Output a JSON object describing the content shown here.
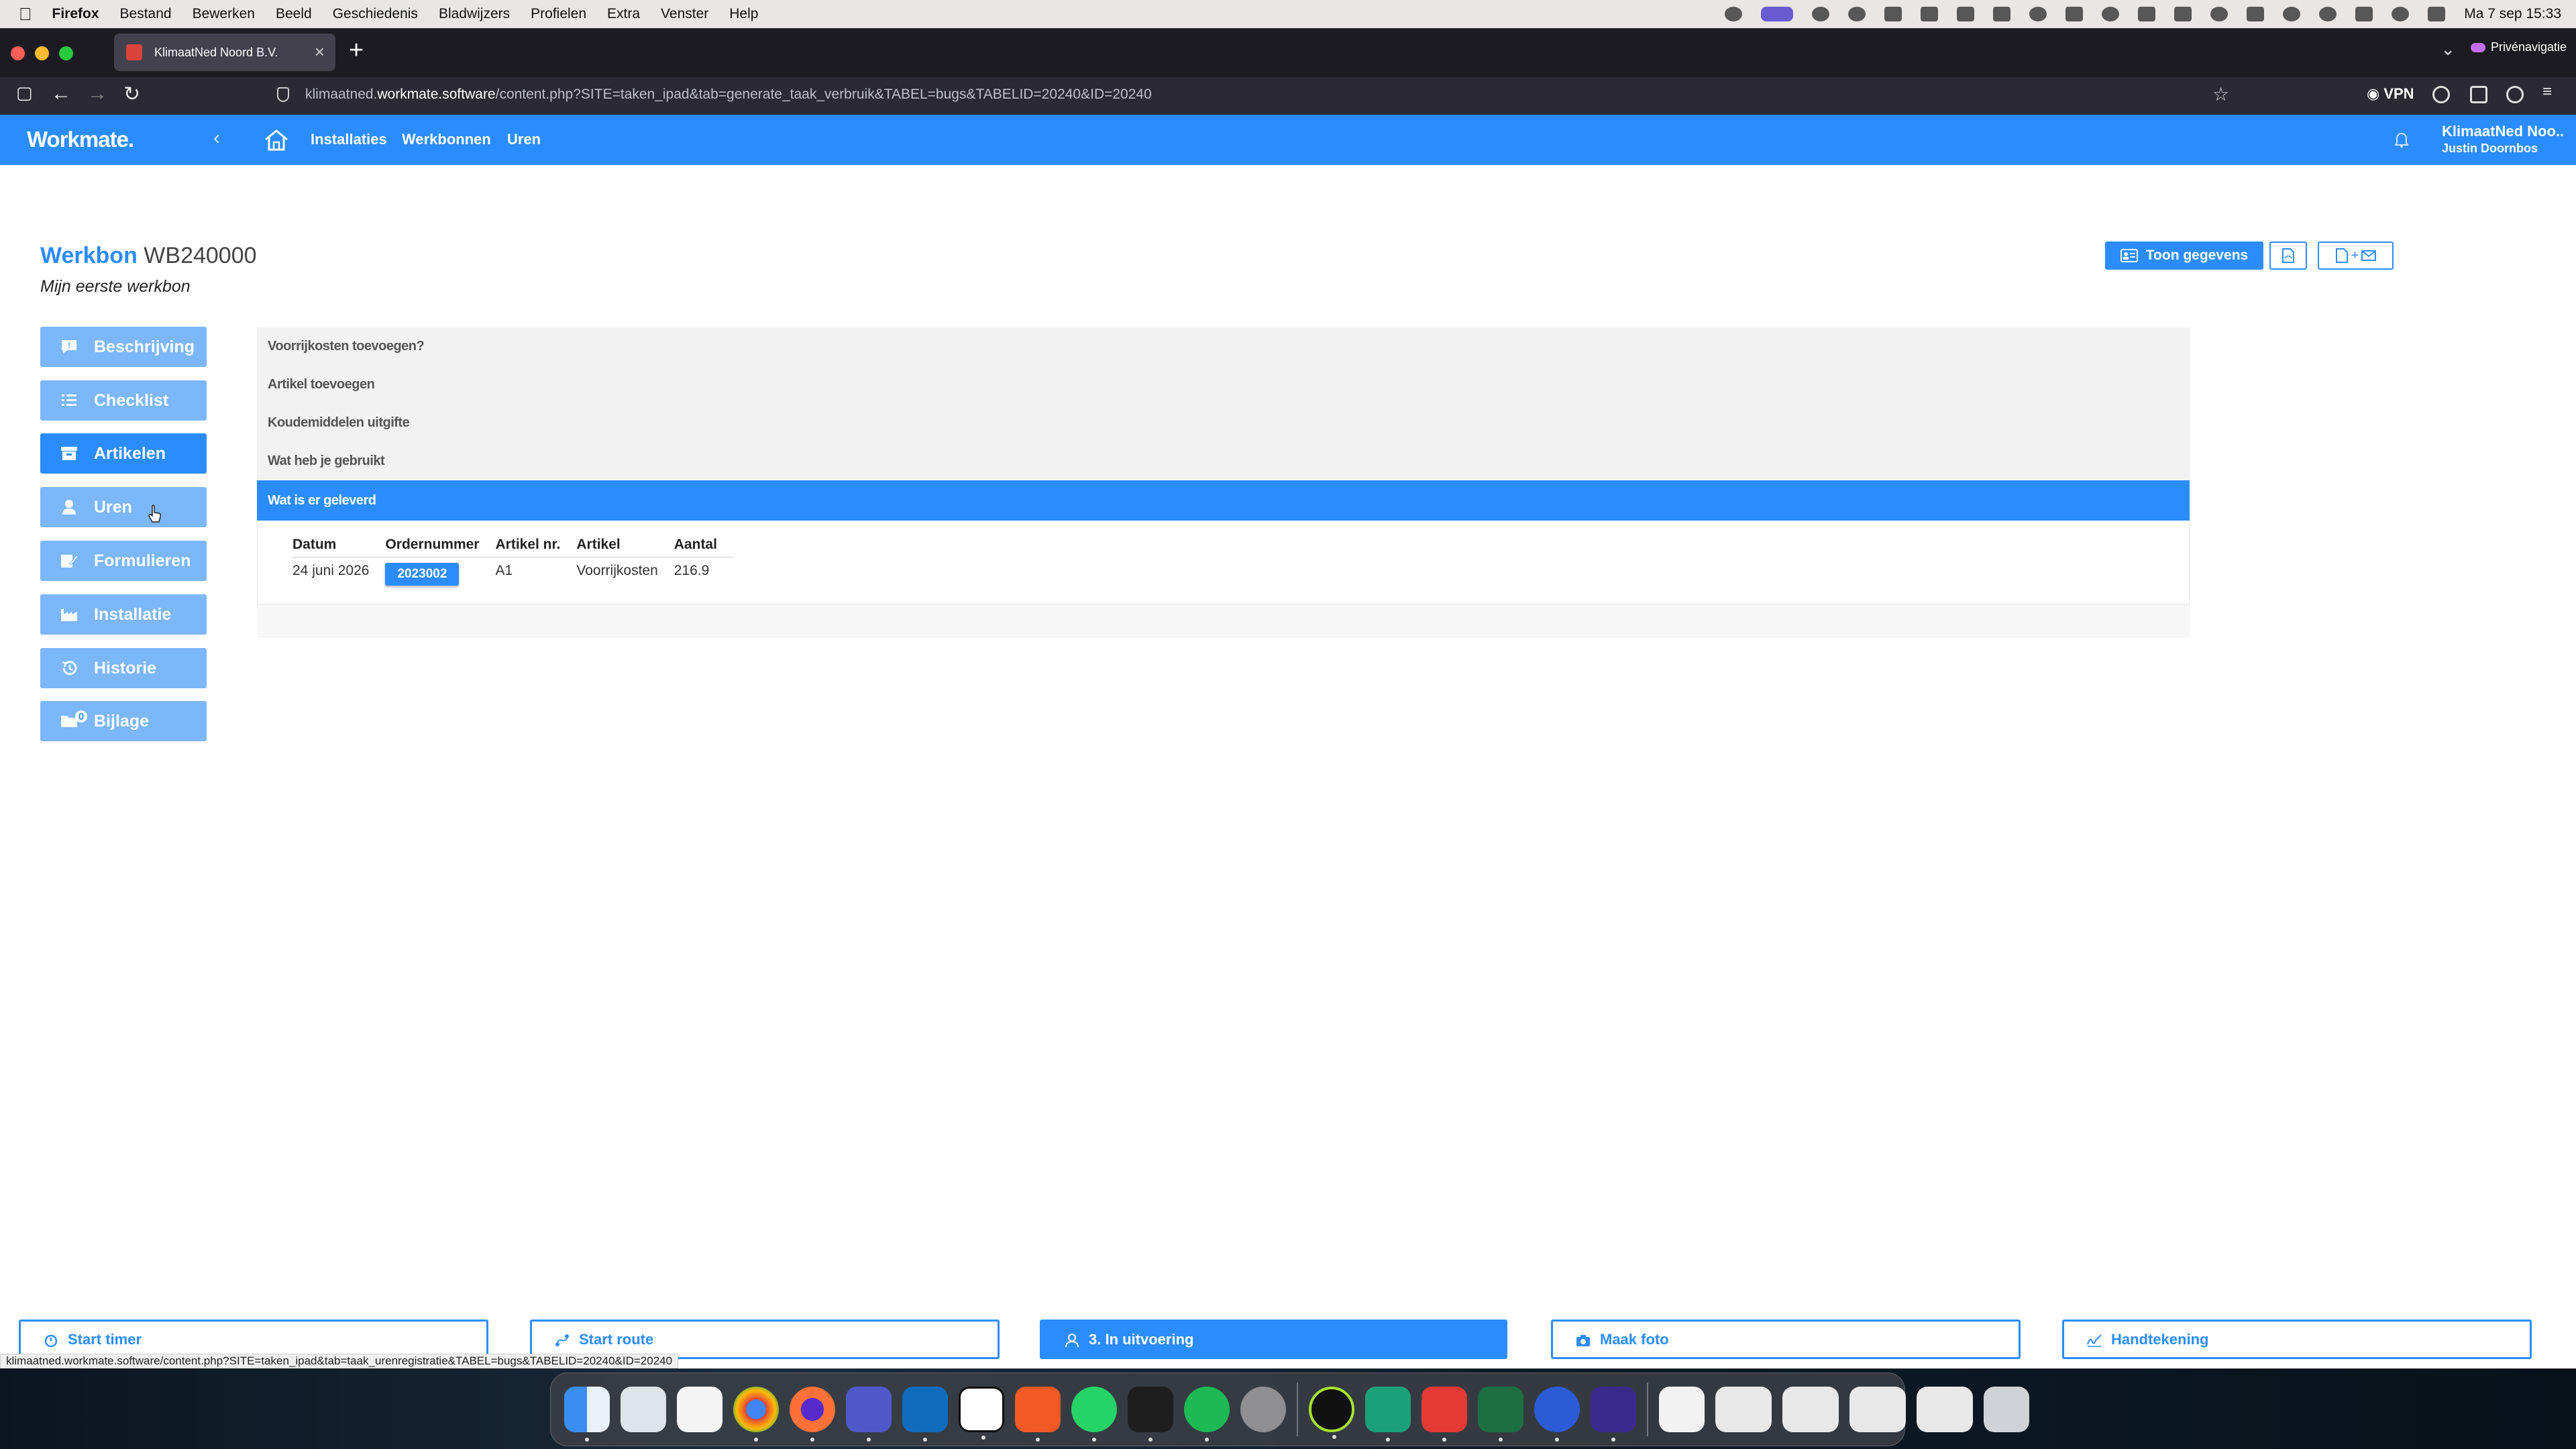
{
  "menubar": {
    "app": "Firefox",
    "items": [
      "Bestand",
      "Bewerken",
      "Beeld",
      "Geschiedenis",
      "Bladwijzers",
      "Profielen",
      "Extra",
      "Venster",
      "Help"
    ],
    "clock": "Ma 7 sep  15:33"
  },
  "browser": {
    "tab_title": "KlimaatNed Noord B.V.",
    "private_label": "Privénavigatie",
    "url_prefix": "klimaatned.",
    "url_domain": "workmate.software",
    "url_rest": "/content.php?SITE=taken_ipad&tab=generate_taak_verbruik&TABEL=bugs&TABELID=20240&ID=20240",
    "vpn_label": "VPN",
    "status_url": "klimaatned.workmate.software/content.php?SITE=taken_ipad&tab=taak_urenregistratie&TABEL=bugs&TABELID=20240&ID=20240"
  },
  "app": {
    "logo": "Workmate.",
    "nav": [
      "Installaties",
      "Werkbonnen",
      "Uren"
    ],
    "account_org": "KlimaatNed Noo..",
    "account_user": "Justin Doornbos",
    "accent": "#2b8cff"
  },
  "page": {
    "title_kind": "Werkbon",
    "title_number": "WB240000",
    "subtitle": "Mijn eerste werkbon",
    "toon_gegevens": "Toon gegevens"
  },
  "sidebar": {
    "items": [
      {
        "label": "Beschrijving",
        "icon": "comment-icon"
      },
      {
        "label": "Checklist",
        "icon": "list-icon"
      },
      {
        "label": "Artikelen",
        "icon": "archive-icon"
      },
      {
        "label": "Uren",
        "icon": "user-icon"
      },
      {
        "label": "Formulieren",
        "icon": "form-icon"
      },
      {
        "label": "Installatie",
        "icon": "factory-icon"
      },
      {
        "label": "Historie",
        "icon": "history-icon"
      },
      {
        "label": "Bijlage",
        "icon": "folder-icon",
        "badge": "0"
      }
    ],
    "active": "Artikelen"
  },
  "accordion": {
    "sections": [
      "Voorrijkosten toevoegen?",
      "Artikel toevoegen",
      "Koudemiddelen uitgifte",
      "Wat heb je gebruikt",
      "Wat is er geleverd"
    ],
    "open": "Wat is er geleverd"
  },
  "table": {
    "headers": [
      "Datum",
      "Ordernummer",
      "Artikel nr.",
      "Artikel",
      "Aantal"
    ],
    "rows": [
      [
        "24 juni 2026",
        "2023002",
        "A1",
        "Voorrijkosten",
        "216.9"
      ]
    ]
  },
  "bottom_bar": {
    "buttons": [
      "Start timer",
      "Start route",
      "3. In uitvoering",
      "Maak foto",
      "Handtekening"
    ]
  }
}
